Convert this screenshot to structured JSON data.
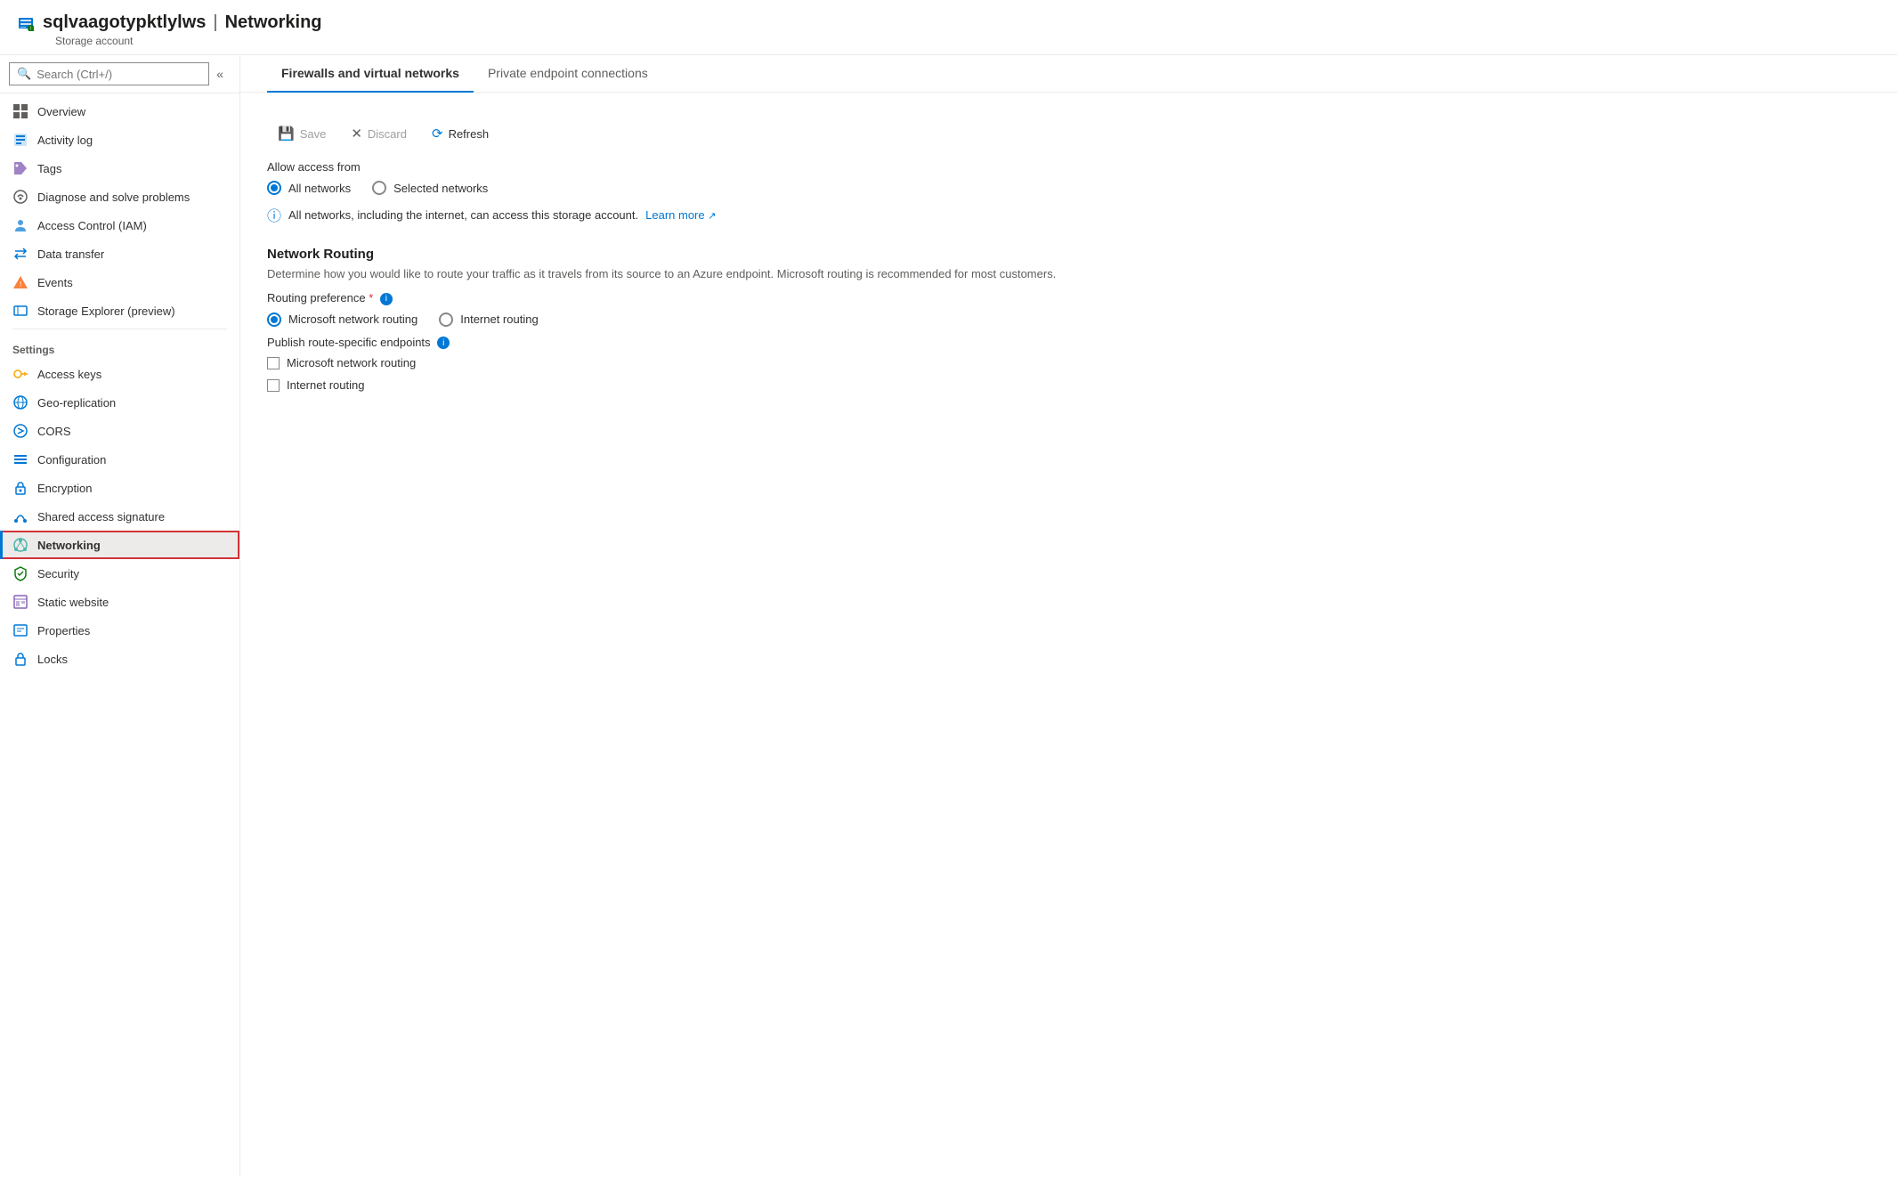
{
  "header": {
    "resource_name": "sqlvaagotypktlylws",
    "page_title": "Networking",
    "resource_type": "Storage account"
  },
  "sidebar": {
    "search_placeholder": "Search (Ctrl+/)",
    "collapse_tooltip": "Collapse sidebar",
    "nav_items": [
      {
        "id": "overview",
        "label": "Overview",
        "icon": "overview-icon",
        "section": "top",
        "active": false
      },
      {
        "id": "activity-log",
        "label": "Activity log",
        "icon": "activity-icon",
        "section": "top",
        "active": false
      },
      {
        "id": "tags",
        "label": "Tags",
        "icon": "tags-icon",
        "section": "top",
        "active": false
      },
      {
        "id": "diagnose",
        "label": "Diagnose and solve problems",
        "icon": "diagnose-icon",
        "section": "top",
        "active": false
      },
      {
        "id": "access-control",
        "label": "Access Control (IAM)",
        "icon": "access-control-icon",
        "section": "top",
        "active": false
      },
      {
        "id": "data-transfer",
        "label": "Data transfer",
        "icon": "data-transfer-icon",
        "section": "top",
        "active": false
      },
      {
        "id": "events",
        "label": "Events",
        "icon": "events-icon",
        "section": "top",
        "active": false
      },
      {
        "id": "storage-explorer",
        "label": "Storage Explorer (preview)",
        "icon": "storage-explorer-icon",
        "section": "top",
        "active": false
      }
    ],
    "settings_items": [
      {
        "id": "access-keys",
        "label": "Access keys",
        "icon": "access-keys-icon",
        "active": false
      },
      {
        "id": "geo-replication",
        "label": "Geo-replication",
        "icon": "geo-icon",
        "active": false
      },
      {
        "id": "cors",
        "label": "CORS",
        "icon": "cors-icon",
        "active": false
      },
      {
        "id": "configuration",
        "label": "Configuration",
        "icon": "config-icon",
        "active": false
      },
      {
        "id": "encryption",
        "label": "Encryption",
        "icon": "encryption-icon",
        "active": false
      },
      {
        "id": "shared-access-signature",
        "label": "Shared access signature",
        "icon": "sas-icon",
        "active": false
      },
      {
        "id": "networking",
        "label": "Networking",
        "icon": "networking-icon",
        "active": true
      },
      {
        "id": "security",
        "label": "Security",
        "icon": "security-icon",
        "active": false
      },
      {
        "id": "static-website",
        "label": "Static website",
        "icon": "static-icon",
        "active": false
      },
      {
        "id": "properties",
        "label": "Properties",
        "icon": "properties-icon",
        "active": false
      },
      {
        "id": "locks",
        "label": "Locks",
        "icon": "locks-icon",
        "active": false
      }
    ],
    "settings_section_label": "Settings"
  },
  "tabs": [
    {
      "id": "firewalls",
      "label": "Firewalls and virtual networks",
      "active": true
    },
    {
      "id": "private-endpoints",
      "label": "Private endpoint connections",
      "active": false
    }
  ],
  "toolbar": {
    "save_label": "Save",
    "discard_label": "Discard",
    "refresh_label": "Refresh"
  },
  "content": {
    "allow_access_from_label": "Allow access from",
    "radio_all_networks": "All networks",
    "radio_selected_networks": "Selected networks",
    "all_networks_info": "All networks, including the internet, can access this storage account.",
    "learn_more_text": "Learn more",
    "network_routing_title": "Network Routing",
    "network_routing_desc": "Determine how you would like to route your traffic as it travels from its source to an Azure endpoint. Microsoft routing is recommended for most customers.",
    "routing_preference_label": "Routing preference",
    "routing_required": "*",
    "radio_microsoft_routing": "Microsoft network routing",
    "radio_internet_routing": "Internet routing",
    "publish_endpoints_label": "Publish route-specific endpoints",
    "checkbox_microsoft_routing": "Microsoft network routing",
    "checkbox_internet_routing": "Internet routing"
  }
}
